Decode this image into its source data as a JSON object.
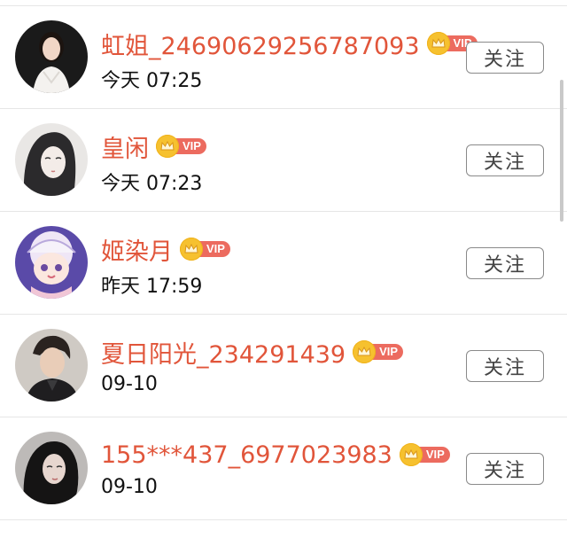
{
  "follow_list": {
    "badge_label": "VIP",
    "colors": {
      "username": "#e1553a",
      "vip_badge": "#ec6b5f",
      "crown": "#f6c12f"
    },
    "users": [
      {
        "username": "虹姐_24690629256787093",
        "time": "今天 07:25",
        "follow_label": "关注",
        "avatar_icon": "avatar-woman-white-dress"
      },
      {
        "username": "皇闲",
        "time": "今天 07:23",
        "follow_label": "关注",
        "avatar_icon": "avatar-illustrated-girl"
      },
      {
        "username": "姬染月",
        "time": "昨天 17:59",
        "follow_label": "关注",
        "avatar_icon": "avatar-anime-girl-purple-hat"
      },
      {
        "username": "夏日阳光_234291439",
        "time": "09-10",
        "follow_label": "关注",
        "avatar_icon": "avatar-man-dark-jacket"
      },
      {
        "username": "155***437_6977023983",
        "time": "09-10",
        "follow_label": "关注",
        "avatar_icon": "avatar-woman-dark-hair"
      }
    ]
  }
}
